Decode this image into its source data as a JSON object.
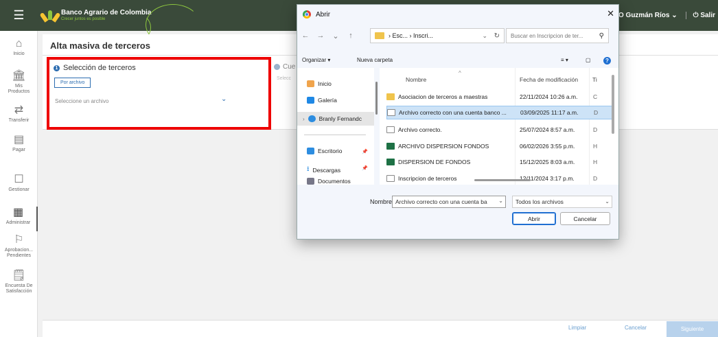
{
  "header": {
    "brand_name": "Banco Agrario de Colombia",
    "brand_slogan": "Crecer juntos es posible",
    "user_name": "LIANO Guzmán Ríos ⌄",
    "logout_label": "Salir",
    "bg_color": "#3a4a3a",
    "accent_color": "#8dc63f"
  },
  "sidebar": {
    "items": [
      {
        "label": "Inicio",
        "icon": "home-icon"
      },
      {
        "label": "Mis Productos",
        "icon": "bank-icon"
      },
      {
        "label": "Transferir",
        "icon": "transfer-icon"
      },
      {
        "label": "Pagar",
        "icon": "pay-icon"
      },
      {
        "label": "Gestionar",
        "icon": "manage-icon"
      },
      {
        "label": "Administrar",
        "icon": "grid-icon"
      },
      {
        "label": "Aprobacion... Pendientes",
        "icon": "flag-icon"
      },
      {
        "label": "Encuesta De Satisfacción",
        "icon": "survey-icon"
      }
    ]
  },
  "main": {
    "title": "Alta masiva de terceros",
    "step1": {
      "title": "Selección de terceros",
      "tab_label": "Por archivo",
      "select_placeholder": "Seleccione un archivo"
    },
    "step2": {
      "title": "Cue",
      "sub": "Selecc"
    },
    "footer": {
      "clear": "Limpiar",
      "cancel": "Cancelar",
      "next": "Siguiente"
    }
  },
  "dialog": {
    "title": "Abrir",
    "address": "› Esc... › Inscri...",
    "search_placeholder": "Buscar en Inscripcion de ter...",
    "toolbar": {
      "organize": "Organizar ▾",
      "new_folder": "Nueva carpeta"
    },
    "nav": [
      {
        "label": "Inicio",
        "icon": "home-icon"
      },
      {
        "label": "Galería",
        "icon": "gallery-icon"
      },
      {
        "label": "Branly Fernandc",
        "icon": "cloud-icon"
      },
      {
        "label": "Escritorio",
        "icon": "desktop-icon"
      },
      {
        "label": "Descargas",
        "icon": "download-icon"
      },
      {
        "label": "Documentos",
        "icon": "documents-icon"
      }
    ],
    "columns": {
      "name": "Nombre",
      "date": "Fecha de modificación",
      "type": "Ti"
    },
    "files": [
      {
        "name": "Asociacion de terceros a maestras",
        "date": "22/11/2024 10:26 a.m.",
        "type": "C",
        "icon": "folder-icon"
      },
      {
        "name": "Archivo correcto con una cuenta banco ...",
        "date": "03/09/2025 11:17 a.m.",
        "type": "D",
        "icon": "text-file-icon"
      },
      {
        "name": "Archivo correcto.",
        "date": "25/07/2024 8:57 a.m.",
        "type": "D",
        "icon": "text-file-icon"
      },
      {
        "name": "ARCHIVO DISPERSION FONDOS",
        "date": "06/02/2026 3:55 p.m.",
        "type": "H",
        "icon": "excel-icon"
      },
      {
        "name": "DISPERSION DE FONDOS",
        "date": "15/12/2025 8:03 a.m.",
        "type": "H",
        "icon": "excel-icon"
      },
      {
        "name": "Inscripcion de terceros",
        "date": "12/11/2024 3:17 p.m.",
        "type": "D",
        "icon": "text-file-icon"
      }
    ],
    "filename_label": "Nombre:",
    "filename_value": "Archivo correcto con una cuenta ba",
    "filetype": "Todos los archivos",
    "open_label": "Abrir",
    "cancel_label": "Cancelar"
  }
}
